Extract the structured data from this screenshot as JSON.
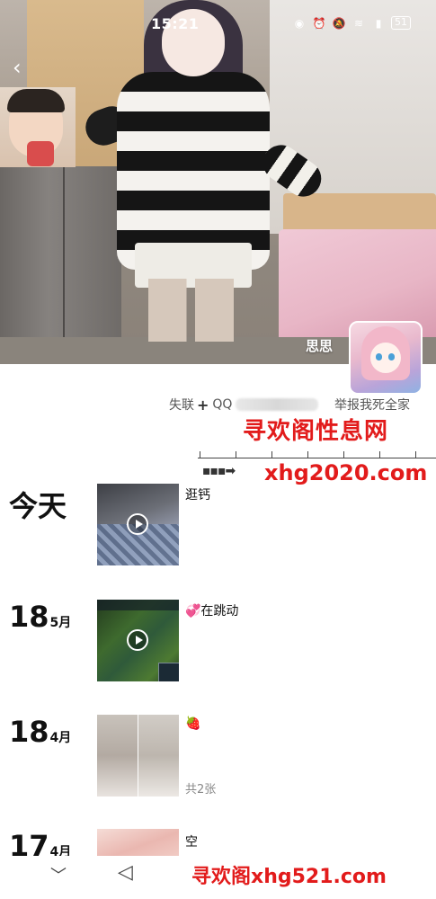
{
  "status_bar": {
    "time": "15:21",
    "icons": [
      "eye-icon",
      "alarm-icon",
      "mute-icon",
      "wifi-icon",
      "signal-icon"
    ],
    "battery": "51"
  },
  "profile": {
    "name": "思思",
    "info_prefix": "失联",
    "info_plus": "+",
    "qq_label": "QQ",
    "report_text": "举报我死全家"
  },
  "watermarks": {
    "site_cn": "寻欢阁性息网",
    "site_url": "xhg2020.com",
    "arrow": "▪▪▪➡",
    "bottom": "寻欢阁xhg521.com"
  },
  "timeline": [
    {
      "day": "今天",
      "month": "",
      "text": "逛钙",
      "sub": "",
      "type": "video"
    },
    {
      "day": "18",
      "month": "5月",
      "text": "💞在跳动",
      "sub": "",
      "type": "video"
    },
    {
      "day": "18",
      "month": "4月",
      "text": "🍓",
      "sub": "共2张",
      "type": "photo"
    },
    {
      "day": "17",
      "month": "4月",
      "text": "空",
      "sub": "",
      "type": "photo"
    }
  ],
  "nav": {
    "down": "﹀",
    "back": "◁"
  },
  "colors": {
    "watermark": "#e21b1b",
    "background": "#ffffff"
  }
}
